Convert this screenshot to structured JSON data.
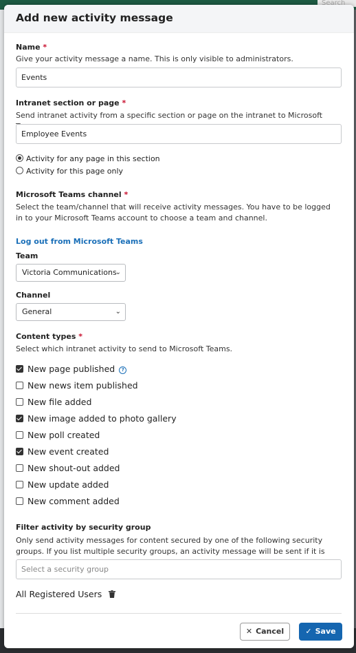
{
  "background": {
    "search_placeholder": "Search"
  },
  "modal": {
    "title": "Add new activity message",
    "name": {
      "label": "Name",
      "required_mark": "*",
      "help": "Give your activity message a name. This is only visible to administrators.",
      "value": "Events"
    },
    "section": {
      "label": "Intranet section or page",
      "required_mark": "*",
      "help": "Send intranet activity from a specific section or page on the intranet to Microsoft Teams.",
      "value": "Employee Events",
      "scope_options": [
        {
          "label": "Activity for any page in this section",
          "selected": true
        },
        {
          "label": "Activity for this page only",
          "selected": false
        }
      ]
    },
    "teams_channel": {
      "label": "Microsoft Teams channel",
      "required_mark": "*",
      "help": "Select the team/channel that will receive activity messages. You have to be logged in to your Microsoft Teams account to choose a team and channel.",
      "logout_link": "Log out from Microsoft Teams",
      "team_label": "Team",
      "team_value": "Victoria Communications",
      "channel_label": "Channel",
      "channel_value": "General"
    },
    "content_types": {
      "label": "Content types",
      "required_mark": "*",
      "help": "Select which intranet activity to send to Microsoft Teams.",
      "items": [
        {
          "label": "New page published",
          "checked": true,
          "help_icon": "question-circle-icon"
        },
        {
          "label": "New news item published",
          "checked": false
        },
        {
          "label": "New file added",
          "checked": false
        },
        {
          "label": "New image added to photo gallery",
          "checked": true
        },
        {
          "label": "New poll created",
          "checked": false
        },
        {
          "label": "New event created",
          "checked": true
        },
        {
          "label": "New shout-out added",
          "checked": false
        },
        {
          "label": "New update added",
          "checked": false
        },
        {
          "label": "New comment added",
          "checked": false
        }
      ]
    },
    "security": {
      "label": "Filter activity by security group",
      "help": "Only send activity messages for content secured by one of the following security groups. If you list multiple security groups, an activity message will be sent if it is secured by any of the groups.",
      "placeholder": "Select a security group",
      "selected_group": "All Registered Users"
    },
    "footer": {
      "cancel_label": "Cancel",
      "save_label": "Save"
    }
  },
  "colors": {
    "accent": "#1566b0",
    "link": "#1a6fb8",
    "required": "#c8102e"
  }
}
